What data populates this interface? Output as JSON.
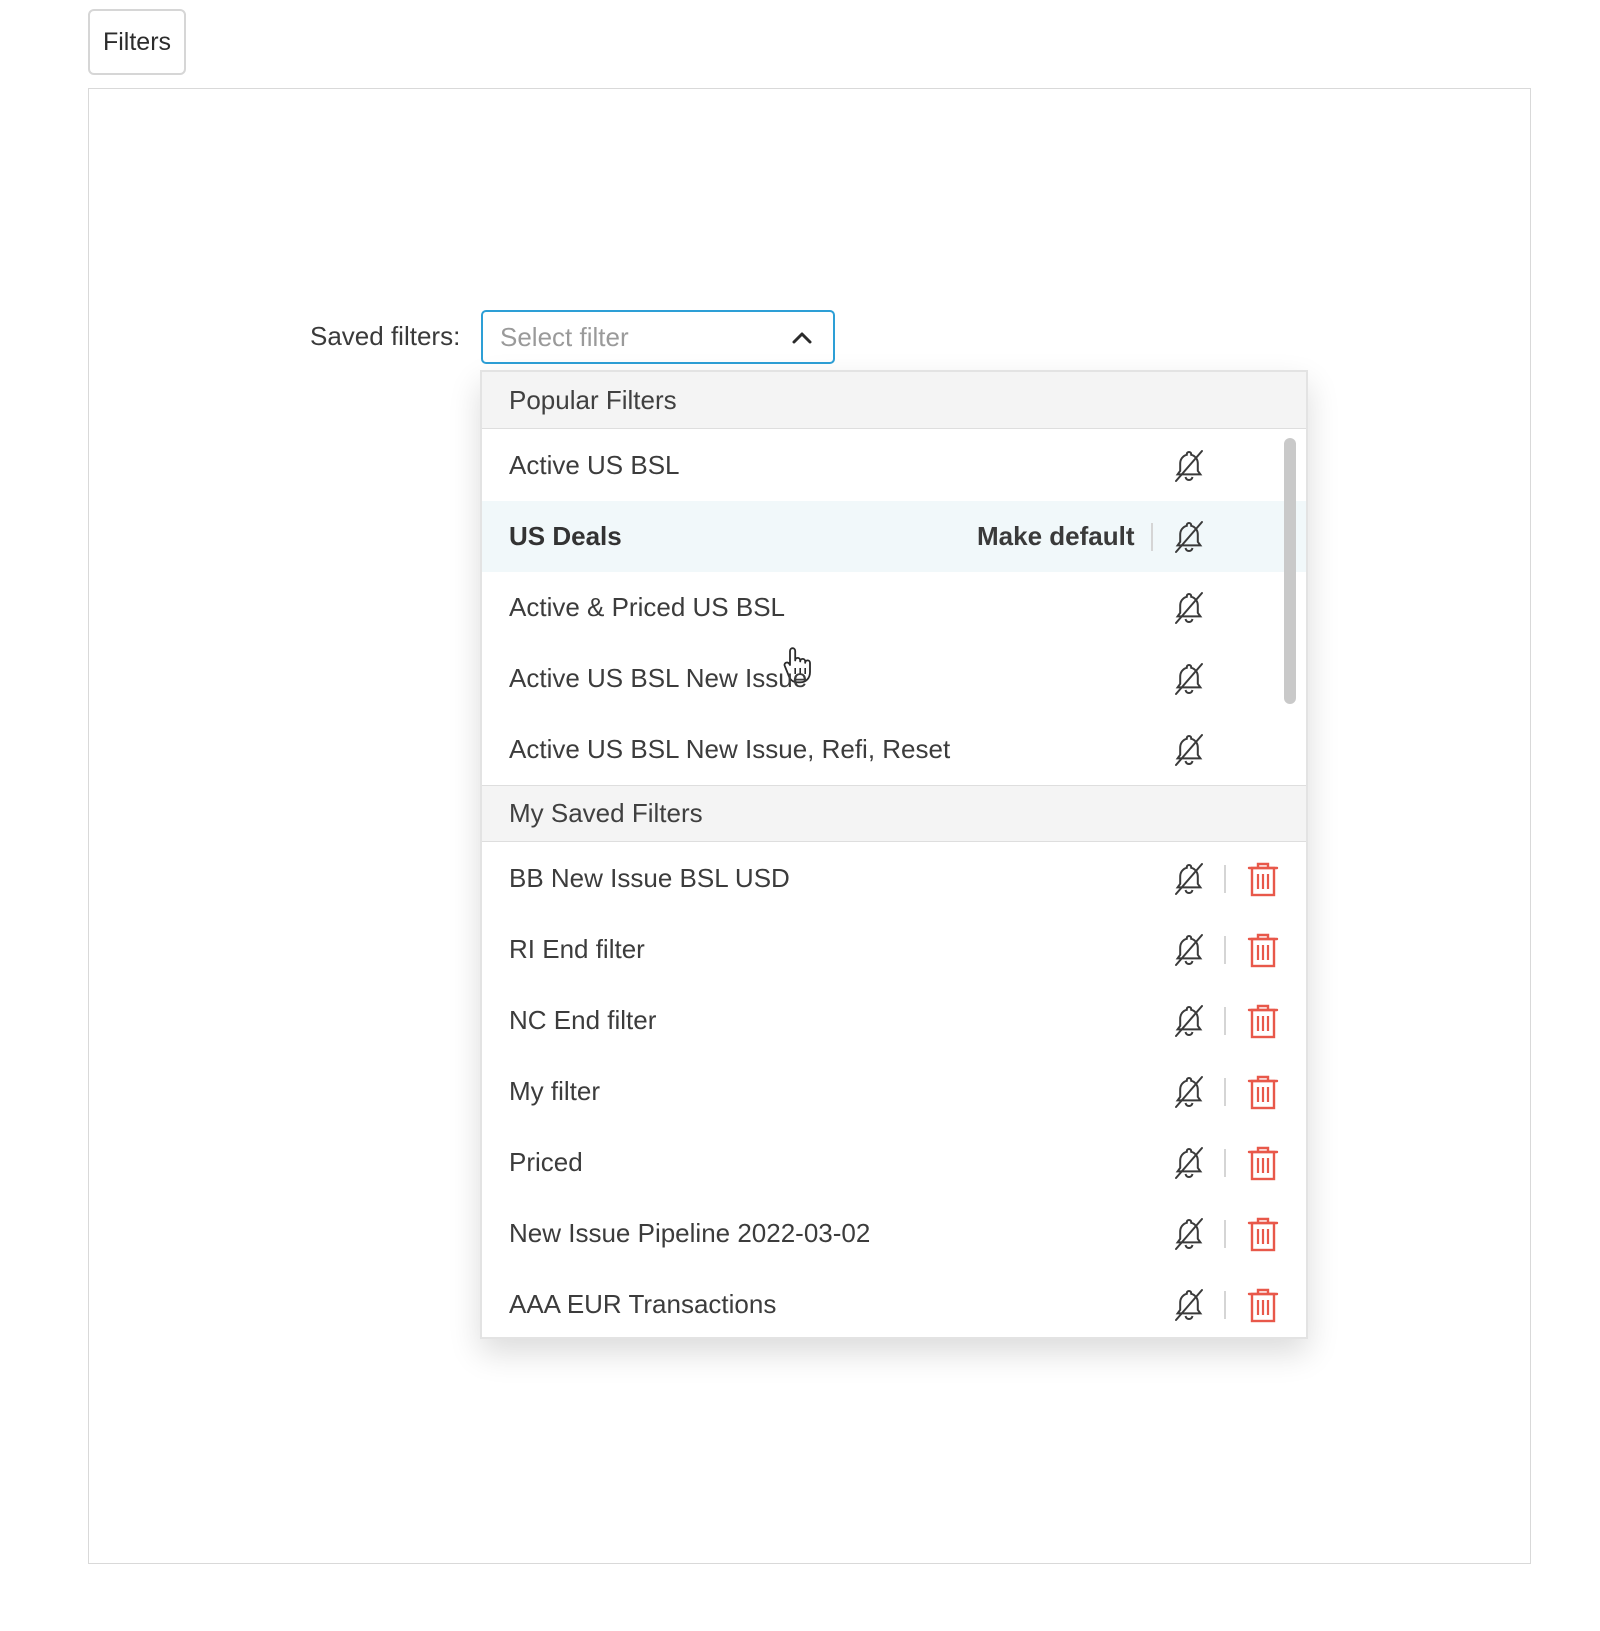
{
  "toolbar": {
    "filters_label": "Filters"
  },
  "saved_filters": {
    "label": "Saved filters:",
    "placeholder": "Select filter"
  },
  "dropdown": {
    "popular": {
      "header": "Popular Filters",
      "items": [
        {
          "label": "Active US BSL"
        },
        {
          "label": "US Deals",
          "hovered": true,
          "action": "Make default"
        },
        {
          "label": "Active & Priced US BSL"
        },
        {
          "label": "Active US BSL New Issue"
        },
        {
          "label": "Active US BSL New Issue, Refi, Reset"
        }
      ]
    },
    "mine": {
      "header": "My Saved Filters",
      "items": [
        {
          "label": "BB New Issue BSL USD"
        },
        {
          "label": "RI End filter"
        },
        {
          "label": "NC End filter"
        },
        {
          "label": "My filter"
        },
        {
          "label": "Priced"
        },
        {
          "label": "New Issue Pipeline 2022-03-02"
        },
        {
          "label": "AAA EUR Transactions"
        }
      ]
    }
  },
  "colors": {
    "accent": "#2d9fd6",
    "delete": "#e8584a",
    "hover_row": "#f1f8fa",
    "header_bg": "#f4f4f4"
  },
  "icons": {
    "bell": "bell-off-icon",
    "trash": "trash-icon",
    "chevron": "chevron-up-icon",
    "cursor": "hand-pointer-icon"
  }
}
